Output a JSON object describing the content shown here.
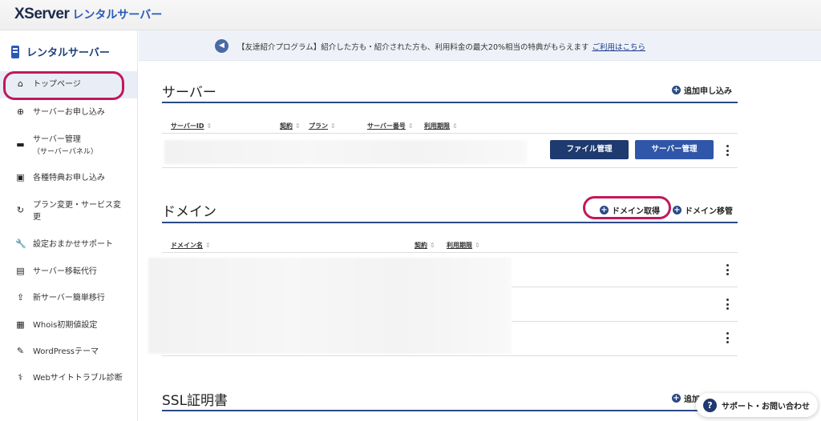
{
  "header": {
    "brand": "XServer",
    "product": "レンタルサーバー"
  },
  "sidebar": {
    "title": "レンタルサーバー",
    "items": [
      {
        "icon": "home-icon",
        "glyph": "⌂",
        "label": "トップページ"
      },
      {
        "icon": "plus-circle-icon",
        "glyph": "⊕",
        "label": "サーバーお申し込み"
      },
      {
        "icon": "server-icon",
        "glyph": "▬",
        "label": "サーバー管理",
        "sub": "（サーバーパネル）"
      },
      {
        "icon": "gift-icon",
        "glyph": "▣",
        "label": "各種特典お申し込み"
      },
      {
        "icon": "refresh-icon",
        "glyph": "↻",
        "label": "プラン変更・サービス変",
        "sub": "更"
      },
      {
        "icon": "wrench-icon",
        "glyph": "🔧",
        "label": "設定おまかせサポート"
      },
      {
        "icon": "server-move-icon",
        "glyph": "▤",
        "label": "サーバー移転代行"
      },
      {
        "icon": "upload-icon",
        "glyph": "⇪",
        "label": "新サーバー簡単移行"
      },
      {
        "icon": "document-icon",
        "glyph": "▦",
        "label": "Whois初期値設定"
      },
      {
        "icon": "edit-icon",
        "glyph": "✎",
        "label": "WordPressテーマ"
      },
      {
        "icon": "stethoscope-icon",
        "glyph": "⚕",
        "label": "Webサイトトラブル診断"
      }
    ]
  },
  "notice": {
    "text": "【友達紹介プログラム】紹介した方も・紹介された方も、利用料金の最大20%相当の特典がもらえます",
    "link": "ご利用はこちら"
  },
  "server_section": {
    "title": "サーバー",
    "add_label": "追加申し込み",
    "columns": [
      "サーバーID",
      "契約",
      "プラン",
      "サーバー番号",
      "利用期限"
    ],
    "file_button": "ファイル管理",
    "server_button": "サーバー管理"
  },
  "domain_section": {
    "title": "ドメイン",
    "acquire_label": "ドメイン取得",
    "transfer_label": "ドメイン移管",
    "columns": [
      "ドメイン名",
      "契約",
      "利用期限"
    ]
  },
  "ssl_section": {
    "title": "SSL証明書",
    "add_label": "追加"
  },
  "support": {
    "label": "サポート・お問い合わせ"
  },
  "sort_glyph": "⇕",
  "colors": {
    "navy": "#1e3a6e",
    "accent_blue": "#2f56a8",
    "highlight": "#c2185b"
  }
}
